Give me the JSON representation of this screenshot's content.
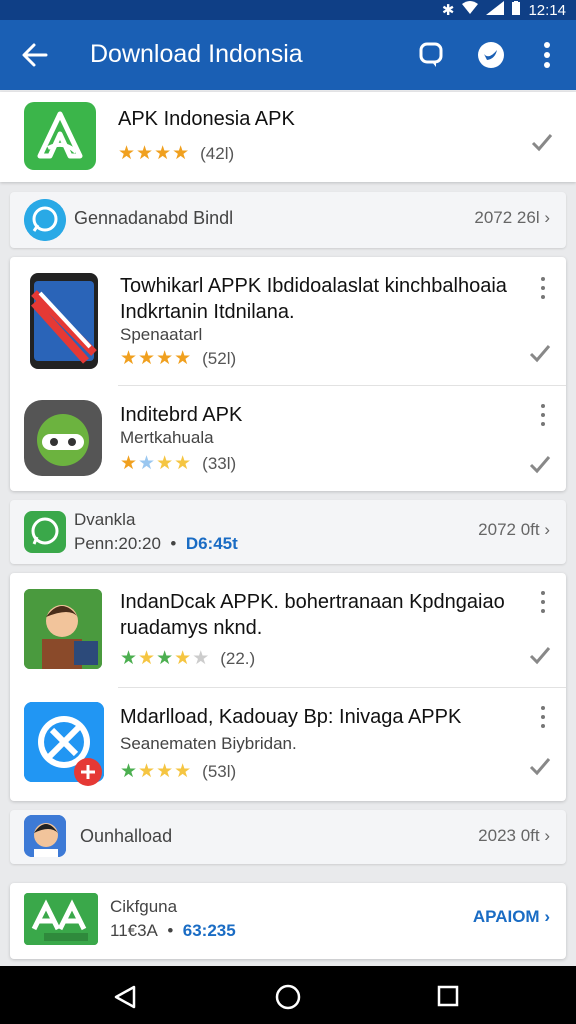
{
  "status": {
    "time": "12:14"
  },
  "appbar": {
    "title": "Download Indonsia"
  },
  "colors": {
    "appbar": "#1a5fb4",
    "accent": "#1a6cc4",
    "star_orange": "#f0a01f",
    "star_green": "#4caf50"
  },
  "featured": {
    "name": "APK Indonesia APK",
    "count": "(42l)",
    "rating": 4
  },
  "sections": [
    {
      "label": "Gennadanabd Bindl",
      "right": "2072 26l"
    },
    {
      "line1": "Dvankla",
      "line2": "Penn:20:20",
      "dot": "•",
      "blue": "D6:45t",
      "right": "2072 0ft"
    },
    {
      "label": "Ounhalload",
      "right": "2023 0ft"
    },
    {
      "line1": "Cikfguna",
      "line2": "11€3A",
      "dot": "•",
      "blue": "63:235",
      "right": "APAIOM"
    }
  ],
  "group1": [
    {
      "title": "Towhikarl APPK Ibdidoalaslat kinchbalhoaia Indkrtanin Itdnilana.",
      "subtitle": "Spenaatarl",
      "count": "(52l)",
      "rating": 4
    },
    {
      "title": "Inditebrd APK",
      "subtitle": "Mertkahuala",
      "count": "(33l)",
      "rating": 4
    }
  ],
  "group2": [
    {
      "title": "IndanDcak APPK. bohertranaan Kpdngaiao ruadamys nknd.",
      "count": "(22.)",
      "rating": 3
    },
    {
      "title": "Mdarlload, Kadouay Bp: Inivaga APPK",
      "subtitle": "Seanematen Biybridan.",
      "count": "(53l)",
      "rating": 4
    }
  ]
}
